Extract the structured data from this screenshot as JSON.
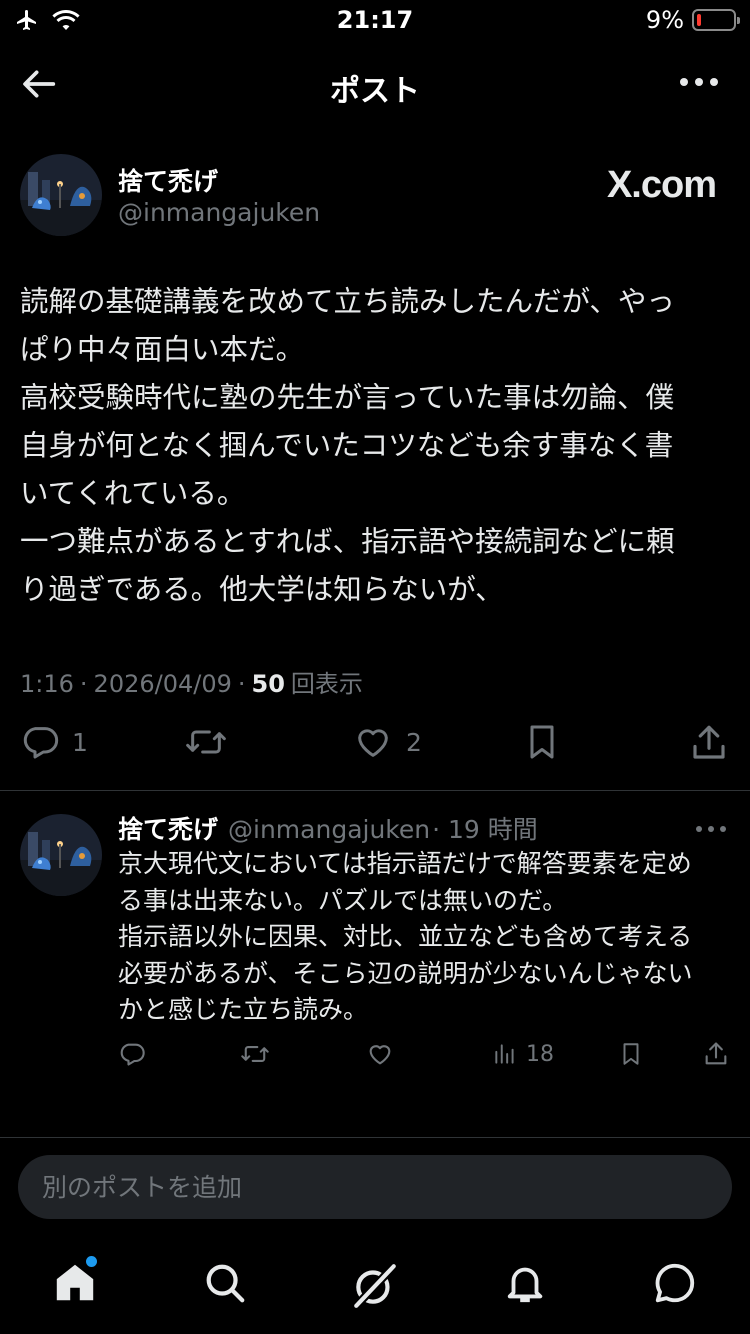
{
  "status_bar": {
    "time": "21:17",
    "battery_percent": "9%",
    "battery_level": 0.09,
    "icons": [
      "airplane-icon",
      "wifi-icon",
      "battery-icon"
    ]
  },
  "header": {
    "title": "ポスト",
    "back_icon": "arrow-left-icon",
    "more_icon": "more-horizontal-icon"
  },
  "post": {
    "author_name": "捨て禿げ",
    "author_handle": "@inmangajuken",
    "watermark": "X.com",
    "text_lines": [
      "読解の基礎講義を改めて立ち読みしたんだが、やっ",
      "ぱり中々面白い本だ。",
      "高校受験時代に塾の先生が言っていた事は勿論、僕",
      "自身が何となく掴んでいたコツなども余す事なく書",
      "いてくれている。",
      "一つ難点があるとすれば、指示語や接続詞などに頼",
      "り過ぎである。他大学は知らないが、"
    ],
    "time": "1:16",
    "date": "2026/04/09",
    "separator": "·",
    "views_count": "50",
    "views_label": "回表示",
    "replies": "1",
    "reposts": "",
    "likes": "2"
  },
  "reply": {
    "author_name": "捨て禿げ",
    "author_handle": "@inmangajuken",
    "time_ago": "· 19 時間",
    "text_lines": [
      "京大現代文においては指示語だけで解答要素を定め",
      "る事は出来ない。パズルでは無いのだ。",
      "指示語以外に因果、対比、並立なども含めて考える",
      "必要があるが、そこら辺の説明が少ないんじゃない",
      "かと感じた立ち読み。"
    ],
    "views": "18"
  },
  "compose": {
    "placeholder": "別のポストを追加"
  },
  "tabbar": {
    "items": [
      "home-icon",
      "search-icon",
      "grok-icon",
      "notifications-icon",
      "messages-icon"
    ],
    "accent": "#1d9bf0"
  },
  "colors": {
    "background": "#000000",
    "text": "#e7e9ea",
    "secondary": "#71767b",
    "divider": "#2f3336",
    "battery_low": "#ff3b30"
  }
}
